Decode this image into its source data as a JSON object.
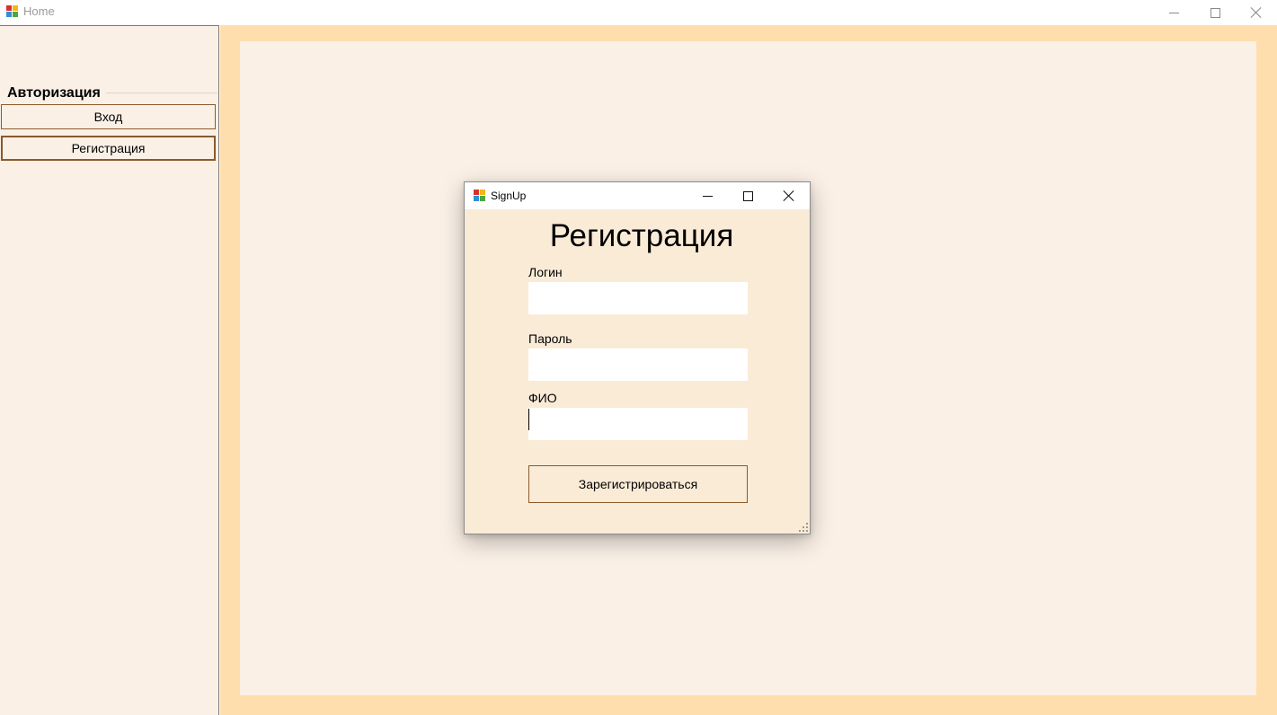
{
  "window": {
    "title": "Home",
    "icon": "app-icon"
  },
  "sidebar": {
    "group_title": "Авторизация",
    "buttons": [
      {
        "label": "Вход"
      },
      {
        "label": "Регистрация"
      }
    ]
  },
  "dialog": {
    "title": "SignUp",
    "heading": "Регистрация",
    "fields": [
      {
        "label": "Логин",
        "value": "",
        "placeholder": ""
      },
      {
        "label": "Пароль",
        "value": "",
        "placeholder": ""
      },
      {
        "label": "ФИО",
        "value": "",
        "placeholder": ""
      }
    ],
    "submit_label": "Зарегистрироваться"
  },
  "colors": {
    "sidebar_bg": "#faf0e6",
    "workspace_border": "#ffdead",
    "workspace_bg": "#faf0e6",
    "dialog_bg": "#faebd7",
    "button_border": "#8b5a2b"
  }
}
